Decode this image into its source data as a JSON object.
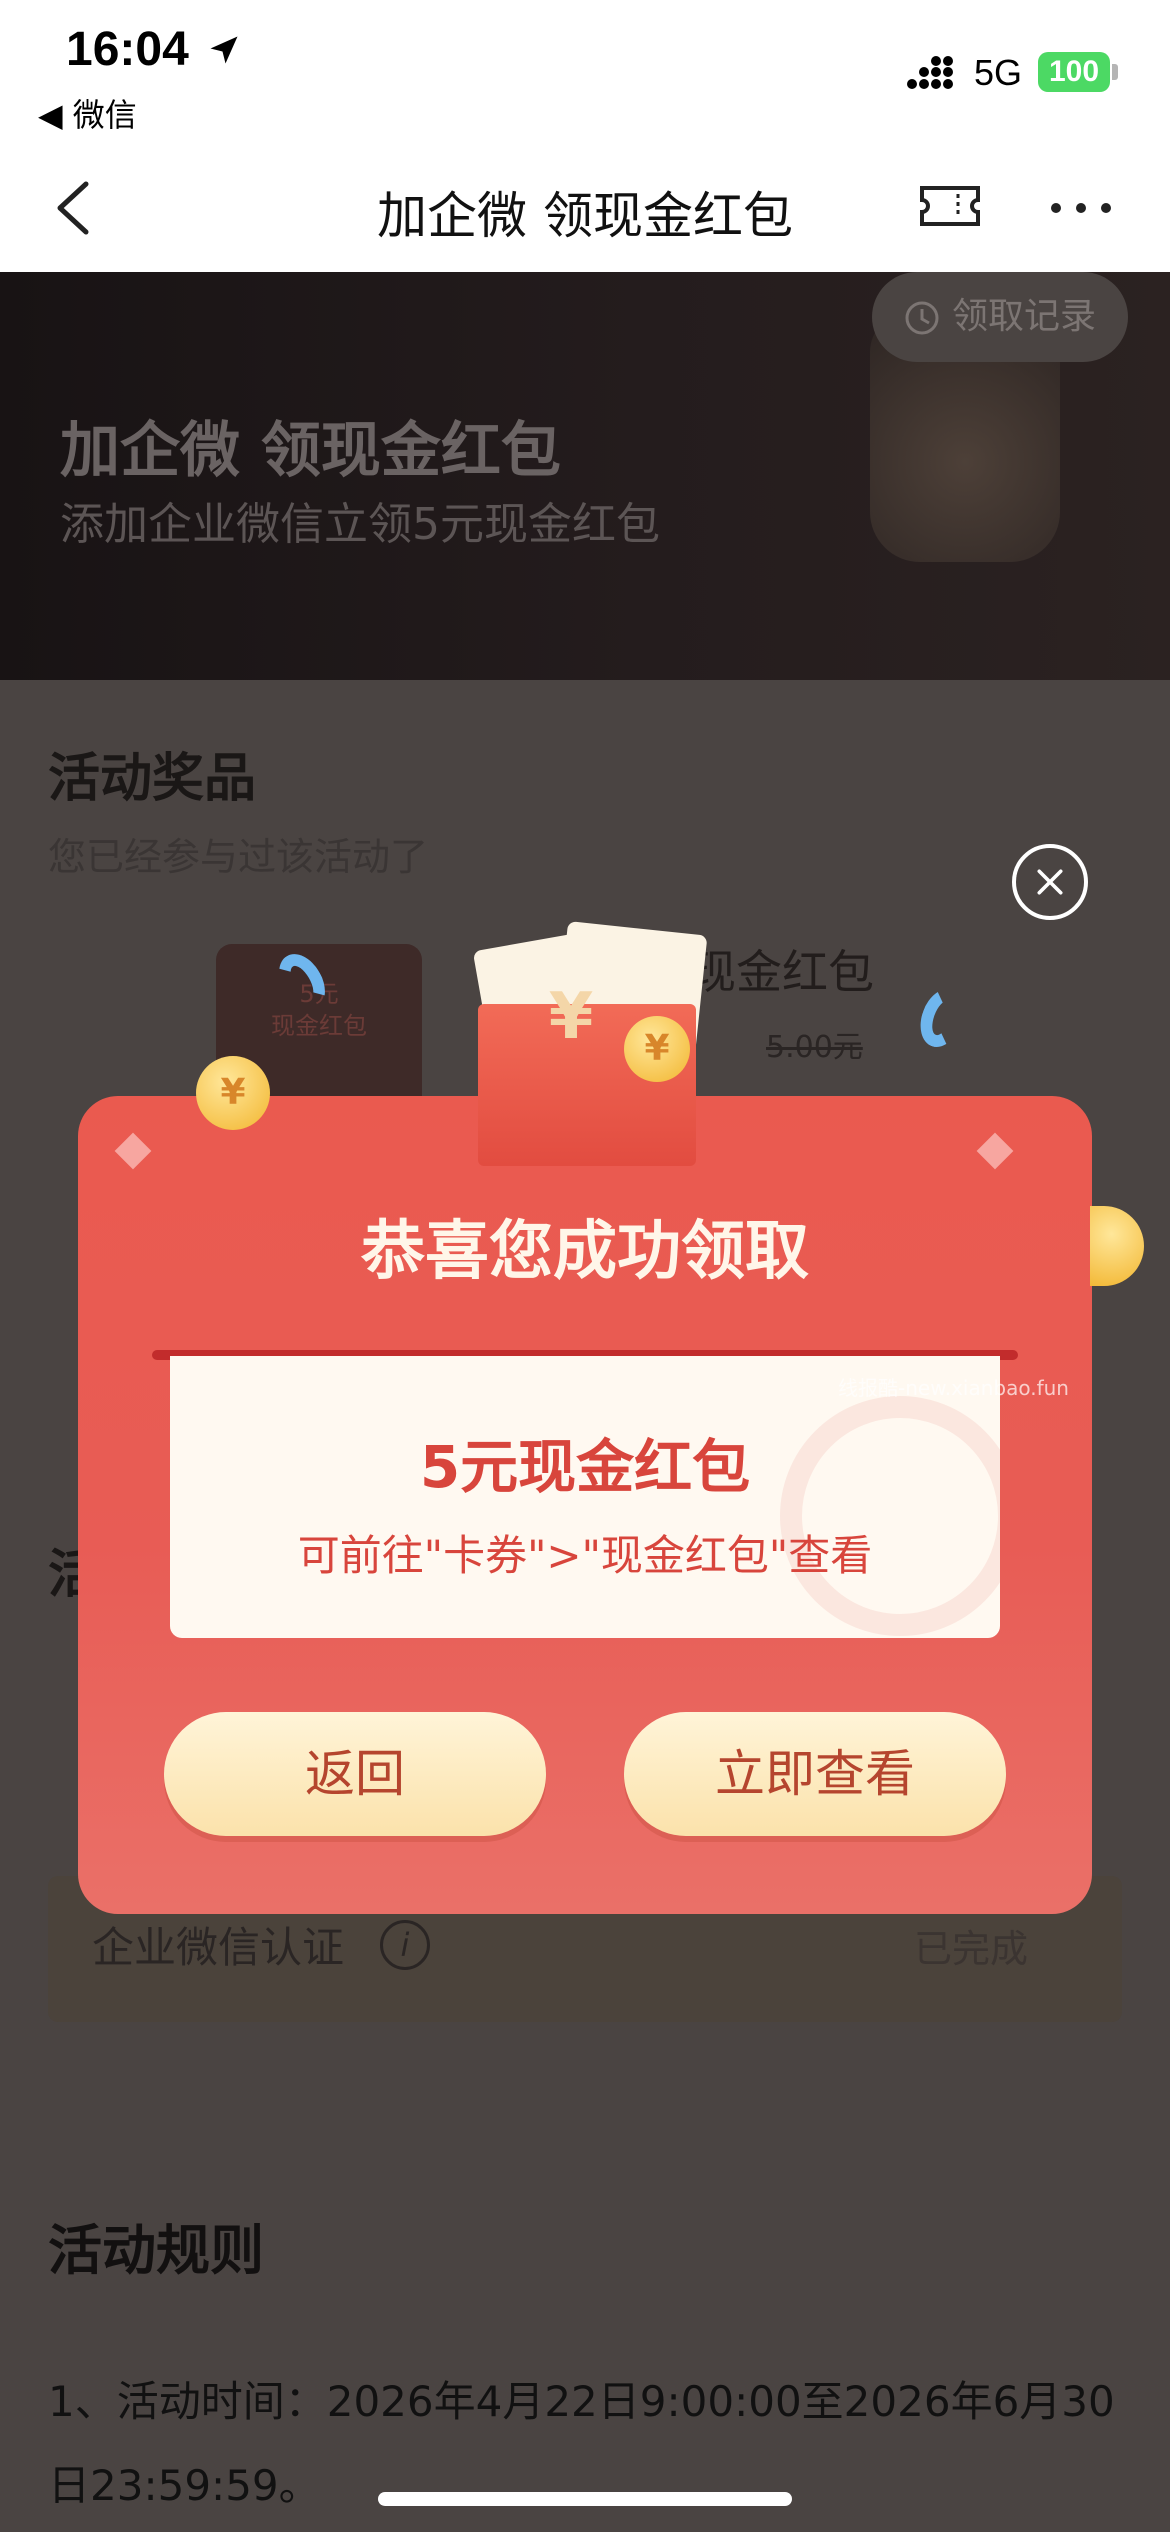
{
  "status_bar": {
    "time": "16:04",
    "back_app": "◀ 微信",
    "network": "5G",
    "battery": "100"
  },
  "nav": {
    "title": "加企微 领现金红包",
    "icons": [
      "back-icon",
      "ticket-icon",
      "more-icon"
    ]
  },
  "banner": {
    "title": "加企微 领现金红包",
    "subtitle": "添加企业微信立领5元现金红包",
    "record_button": "领取记录"
  },
  "prizes": {
    "title": "活动奖品",
    "subtitle": "您已经参与过该活动了",
    "card_amount": "5元",
    "card_label": "现金红包",
    "name": "现金红包",
    "original_price": "5.00元"
  },
  "tasks": {
    "title_partial": "活",
    "item_name": "企业微信认证",
    "item_status": "已完成"
  },
  "rules": {
    "title": "活动规则",
    "text": "1、活动时间：2026年4月22日9:00:00至2026年6月30日23:59:59。"
  },
  "modal": {
    "title": "恭喜您成功领取",
    "prize": "5元现金红包",
    "hint": "可前往\"卡券\">\"现金红包\"查看",
    "back_button": "返回",
    "view_button": "立即查看",
    "coin_symbol": "¥"
  },
  "watermark": "线报酷-new.xianbao.fun",
  "colors": {
    "modal_red": "#ea5a4f",
    "button_cream": "#fbe2ab",
    "button_text": "#b5452e",
    "overlay": "#4a4442"
  }
}
